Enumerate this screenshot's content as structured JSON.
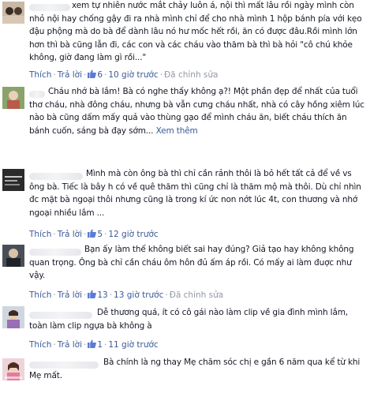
{
  "labels": {
    "like": "Thích",
    "reply": "Trả lời",
    "edited": "Đã chỉnh sửa",
    "see_more": "Xem thêm",
    "dot": "·"
  },
  "comments": [
    {
      "text": "xem tự nhiên nước mắt chảy luôn á, nội thì mất lâu rồi ngày mình còn nhỏ nội hay chống gậy đi ra nhà mình chỉ để cho nhà mình 1 hộp bánh pía với kẹo đậu phộng mà do bà để dành lâu nó hư mốc hết rồi, ăn có được đâu.Rồi mình lớn hơn thì bà cũng lẫn đi, các con và các cháu vào thăm bà thì bà hỏi \"cô chú khỏe không, giờ đang làm gì rồi...\"",
      "likes": "6",
      "time": "10 giờ trước",
      "edited": true,
      "see_more": false
    },
    {
      "text": "Cháu nhớ bà lắm! Bà có nghe thấy không ạ?! Một phần đẹp để nhất của tuổi thơ cháu, nhà đông cháu, nhưng bà vẫn cưng cháu nhất, nhà có cây hồng xiêm lúc nào bà cũng dấm mấy quả vào thùng gạo để mình cháu ăn, biết cháu thích ăn bánh cuốn, sáng bà đạy sớm...",
      "likes": "",
      "time": "",
      "edited": false,
      "see_more": true
    },
    {
      "text": "Mình mà còn ông bà thì chỉ cần rảnh thôi là bỏ hết tất cả để về vs ông bà. Tiếc là bây h có về quê thăm thì cũng chỉ là thăm mộ mà thôi. Dù chỉ nhìn đc mặt bà ngoại thôi nhưng cũng là trong kí ức non nớt lúc 4t, con thương và nhớ ngoại nhiều lắm ...",
      "likes": "5",
      "time": "12 giờ trước",
      "edited": false,
      "see_more": false
    },
    {
      "text": "Bạn ấy làm thế không biết sai hay đúng? Giả tạo hay không không quan trọng. Ông bà chỉ cần cháu ôm hôn đủ ấm áp rồi. Có mấy ai làm đuợc như vậy.",
      "likes": "13",
      "time": "13 giờ trước",
      "edited": true,
      "see_more": false
    },
    {
      "text": "Dễ thương quá, ít có cô gái nào làm clip về gia đình mình lắm, toàn làm clip ngựa bà không à",
      "likes": "1",
      "time": "11 giờ trước",
      "edited": false,
      "see_more": false
    },
    {
      "text": "Bà chính là ng thay Mẹ chăm sóc chị e gần 6 năm qua kể từ khi Mẹ mất.",
      "likes": "",
      "time": "",
      "edited": false,
      "see_more": false
    }
  ],
  "colors": {
    "link": "#3b5998",
    "meta": "#9197a3",
    "text": "#141823"
  }
}
